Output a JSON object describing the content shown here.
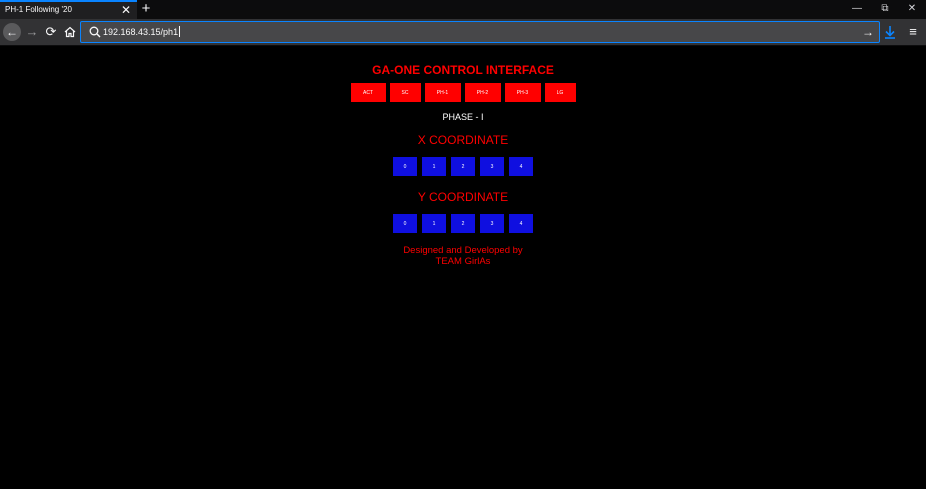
{
  "browser": {
    "tab_title": "PH-1 Following '20",
    "tab_close": "✕",
    "new_tab": "+",
    "window_controls": {
      "minimize": "—",
      "restore": "⧉",
      "close": "✕"
    },
    "url": "192.168.43.15/ph1",
    "icons": [
      "back-arrow",
      "forward-arrow",
      "reload",
      "home",
      "search",
      "go-arrow",
      "download",
      "hamburger-menu"
    ]
  },
  "page": {
    "title": "GA-ONE CONTROL INTERFACE",
    "nav_buttons": [
      "ACT",
      "SC",
      "PH-1",
      "PH-2",
      "PH-3",
      "LG"
    ],
    "phase_label": "PHASE - I",
    "x_heading": "X COORDINATE",
    "x_buttons": [
      "0",
      "1",
      "2",
      "3",
      "4"
    ],
    "y_heading": "Y COORDINATE",
    "y_buttons": [
      "0",
      "1",
      "2",
      "3",
      "4"
    ],
    "credit_line1": "Designed and Developed by",
    "credit_line2": "TEAM GirlAs"
  },
  "colors": {
    "accent_red": "#ff0000",
    "button_blue": "#0f0fe0",
    "background": "#000000",
    "chrome_accent": "#0a84ff"
  }
}
